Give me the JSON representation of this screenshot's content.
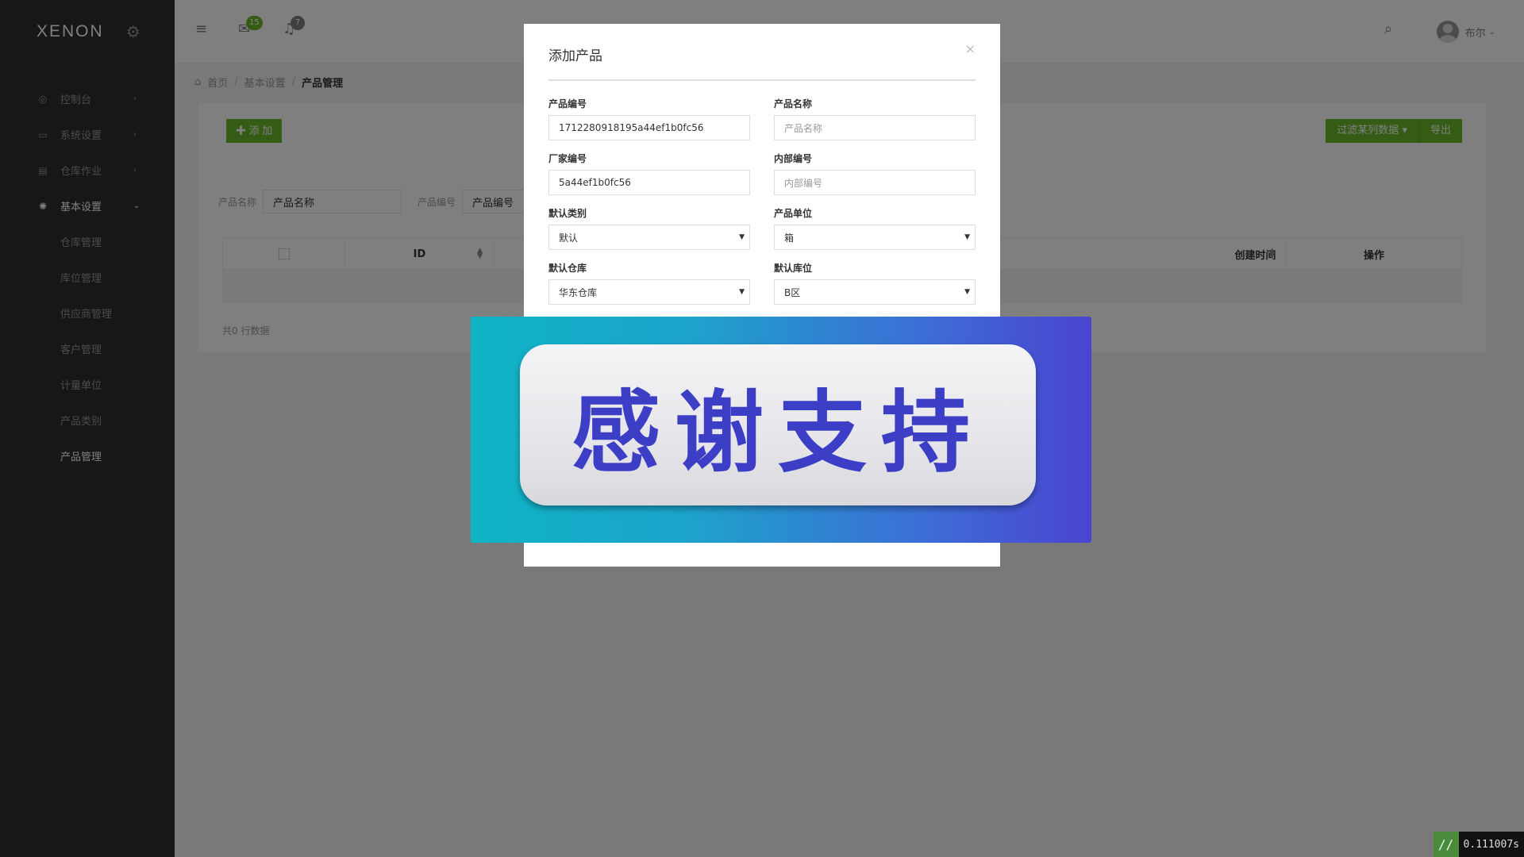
{
  "brand": {
    "name": "XENON"
  },
  "topbar": {
    "messages_count": "15",
    "notifications_count": "7",
    "user_name": "布尔"
  },
  "sidebar": {
    "items": [
      {
        "label": "控制台"
      },
      {
        "label": "系统设置"
      },
      {
        "label": "仓库作业"
      },
      {
        "label": "基本设置"
      }
    ],
    "sub_items": [
      {
        "label": "仓库管理"
      },
      {
        "label": "库位管理"
      },
      {
        "label": "供应商管理"
      },
      {
        "label": "客户管理"
      },
      {
        "label": "计量单位"
      },
      {
        "label": "产品类别"
      },
      {
        "label": "产品管理"
      }
    ]
  },
  "breadcrumb": {
    "home": "首页",
    "level1": "基本设置",
    "current": "产品管理"
  },
  "panel": {
    "add_label": "添 加",
    "filter_button": "过滤某列数据",
    "export_button": "导出",
    "filter_name_label": "产品名称",
    "filter_name_value": "产品名称",
    "filter_code_label": "产品编号",
    "filter_code_value": "产品编号",
    "table": {
      "col_id": "ID",
      "col_created": "创建时间",
      "col_action": "操作"
    },
    "total": "共0 行数据"
  },
  "modal": {
    "title": "添加产品",
    "close": "×",
    "fields": {
      "code_label": "产品编号",
      "code_value": "1712280918195a44ef1b0fc56",
      "name_label": "产品名称",
      "name_placeholder": "产品名称",
      "factory_label": "厂家编号",
      "factory_value": "5a44ef1b0fc56",
      "internal_label": "内部编号",
      "internal_placeholder": "内部编号",
      "category_label": "默认类别",
      "category_value": "默认",
      "unit_label": "产品单位",
      "unit_value": "箱",
      "warehouse_label": "默认仓库",
      "warehouse_value": "华东仓库",
      "location_label": "默认库位",
      "location_value": "B区"
    }
  },
  "banner": {
    "text": "感谢支持"
  },
  "timer": {
    "value": "0.111007s"
  },
  "colors": {
    "accent": "#68b828",
    "sidebar": "#2c2e2f"
  }
}
